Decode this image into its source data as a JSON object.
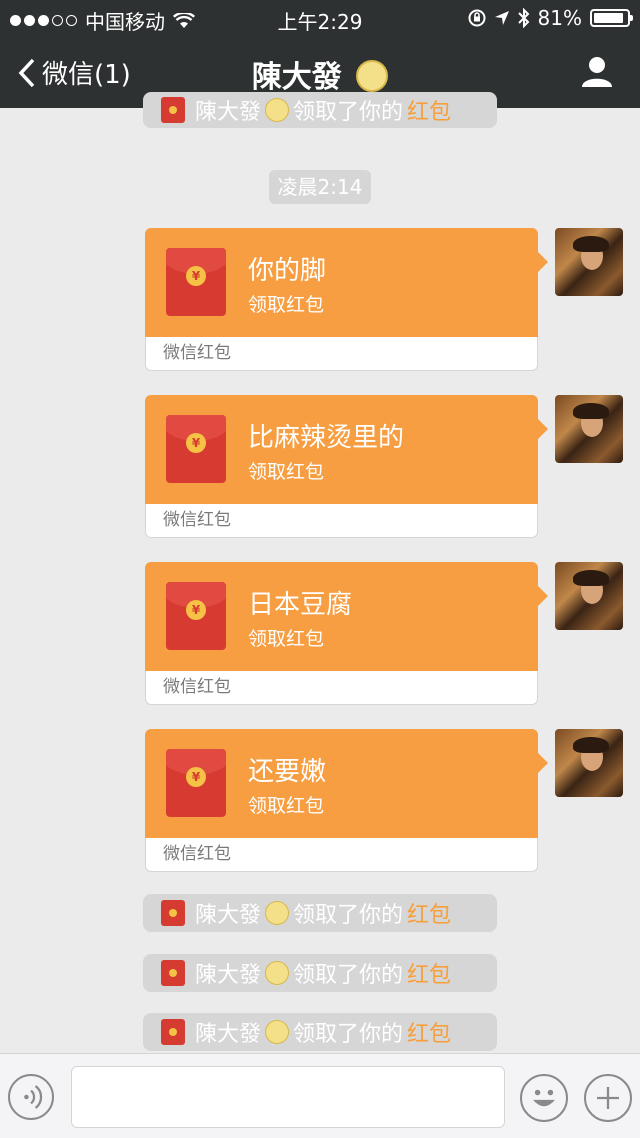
{
  "status_bar": {
    "carrier": "中国移动",
    "time": "上午2:29",
    "battery": "81%",
    "battery_level": 0.81
  },
  "nav": {
    "back_label": "微信(1)",
    "title": "陳大發"
  },
  "chat": {
    "timestamp": "凌晨2:14",
    "notice_top": {
      "name": "陳大發",
      "text": "领取了你的",
      "link": "红包"
    },
    "red_packets": [
      {
        "title": "你的脚",
        "subtitle": "领取红包",
        "footer": "微信红包"
      },
      {
        "title": "比麻辣烫里的",
        "subtitle": "领取红包",
        "footer": "微信红包"
      },
      {
        "title": "日本豆腐",
        "subtitle": "领取红包",
        "footer": "微信红包"
      },
      {
        "title": "还要嫩",
        "subtitle": "领取红包",
        "footer": "微信红包"
      }
    ],
    "notices": [
      {
        "name": "陳大發",
        "text": "领取了你的",
        "link": "红包"
      },
      {
        "name": "陳大發",
        "text": "领取了你的",
        "link": "红包"
      },
      {
        "name": "陳大發",
        "text": "领取了你的",
        "link": "红包"
      }
    ]
  },
  "icons": {
    "back": "chevron-left-icon",
    "user": "user-icon",
    "voice": "voice-icon",
    "emoji": "emoji-icon",
    "plus": "plus-icon",
    "red_packet": "red-envelope-icon"
  },
  "colors": {
    "navbar": "#2e3132",
    "red_packet_orange": "#f79e42",
    "envelope_red": "#d63a31",
    "link_orange": "#f79f3b",
    "chat_background": "#ebebeb"
  }
}
